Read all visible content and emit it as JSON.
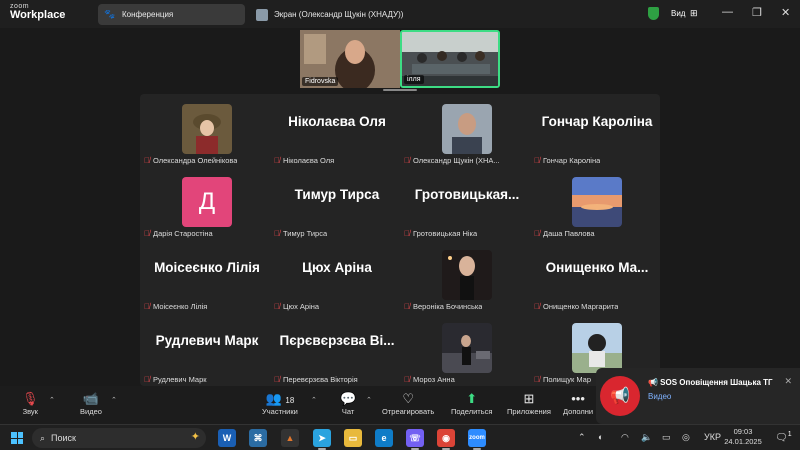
{
  "app": {
    "logo_small": "zoom",
    "logo_big": "Workplace"
  },
  "tabs": [
    {
      "label": "Конференция",
      "icon": "paw-icon"
    },
    {
      "label": "Экран (Олександр Щукін (ХНАДУ))",
      "icon": "screen-share-icon"
    }
  ],
  "titlebar": {
    "view_label": "Вид",
    "shield_color": "#2ea043"
  },
  "top_strip": [
    {
      "name": "Fidrovska"
    },
    {
      "name": "ілля"
    }
  ],
  "participants": [
    {
      "label": "Олександра Олейнікова",
      "display": "",
      "type": "photo",
      "photo": "warm"
    },
    {
      "label": "Ніколаєва Оля",
      "display": "Ніколаєва Оля",
      "type": "name"
    },
    {
      "label": "Олександр Щукін (ХНА...",
      "display": "",
      "type": "photo",
      "photo": "man"
    },
    {
      "label": "Гончар Кароліна",
      "display": "Гончар Кароліна",
      "type": "name"
    },
    {
      "label": "Дарія Старостіна",
      "display": "Д",
      "type": "letter",
      "color": "#e2457a"
    },
    {
      "label": "Тимур Тирса",
      "display": "Тимур Тирса",
      "type": "name"
    },
    {
      "label": "Гротовицькая Ніка",
      "display": "Гротовицькая...",
      "type": "name"
    },
    {
      "label": "Даша Павлова",
      "display": "",
      "type": "photo",
      "photo": "sunset"
    },
    {
      "label": "Моісеєнко Лілія",
      "display": "Моісеєнко Лілія",
      "type": "name"
    },
    {
      "label": "Цюх Аріна",
      "display": "Цюх Аріна",
      "type": "name"
    },
    {
      "label": "Вероніка Бочинська",
      "display": "",
      "type": "photo",
      "photo": "night"
    },
    {
      "label": "Онищенко Маргарита",
      "display": "Онищенко  Ма...",
      "type": "name"
    },
    {
      "label": "Рудлевич Марк",
      "display": "Рудлевич Марк",
      "type": "name"
    },
    {
      "label": "Перевєрзєва Вікторія",
      "display": "Пєрєвєрзєва Ві...",
      "type": "name"
    },
    {
      "label": "Мороз Анна",
      "display": "",
      "type": "photo",
      "photo": "night2"
    },
    {
      "label": "Полищук Мар",
      "display": "",
      "type": "photo",
      "photo": "moto"
    }
  ],
  "toolbar": {
    "audio": "Звук",
    "video": "Видео",
    "participants": "Участники",
    "participants_count": "18",
    "chat": "Чат",
    "react": "Отреагировать",
    "share": "Поделиться",
    "apps": "Приложения",
    "more": "Дополни"
  },
  "notification": {
    "title": "📢 SOS Оповіщення Шацька ТГ",
    "subtitle": "Видео"
  },
  "taskbar": {
    "search_placeholder": "Поиск",
    "lang": "УКР",
    "time": "09:03",
    "date": "24.01.2025",
    "badge": "1"
  }
}
